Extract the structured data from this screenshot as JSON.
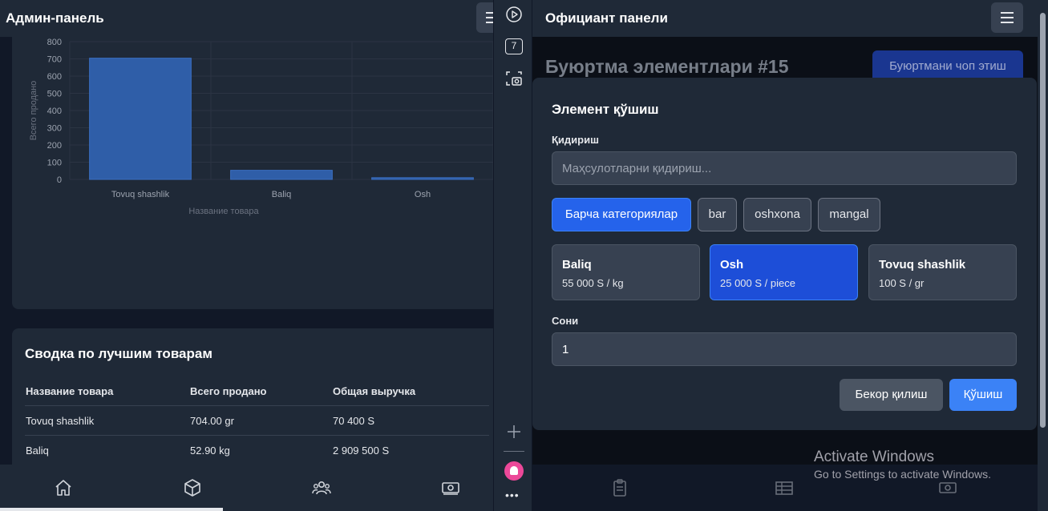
{
  "admin": {
    "title": "Админ-панель",
    "chart_data": {
      "type": "bar",
      "categories": [
        "Tovuq shashlik",
        "Baliq",
        "Osh"
      ],
      "values": [
        704,
        52.9,
        10
      ],
      "xlabel": "Название товара",
      "ylabel": "Всего продано",
      "ylim": [
        0,
        800
      ],
      "yticks": [
        "0",
        "100",
        "200",
        "300",
        "400",
        "500",
        "600",
        "700",
        "800"
      ],
      "grid": true,
      "bar_color": "#2f5ea8"
    },
    "summary": {
      "title": "Сводка по лучшим товарам",
      "columns": [
        "Название товара",
        "Всего продано",
        "Общая выручка"
      ],
      "rows": [
        [
          "Tovuq shashlik",
          "704.00 gr",
          "70 400 S"
        ],
        [
          "Baliq",
          "52.90 kg",
          "2 909 500 S"
        ]
      ]
    },
    "nav_icons": [
      "home-icon",
      "box-icon",
      "users-icon",
      "cash-icon"
    ]
  },
  "strip": {
    "badge": "7",
    "icons": [
      "play-icon",
      "screenshot-icon",
      "plus-icon",
      "avatar-icon",
      "more-icon"
    ],
    "more": "•••"
  },
  "waiter": {
    "title": "Официант панели",
    "order_title": "Буюртма элементлари #15",
    "print_button": "Буюртмани чоп этиш",
    "modal": {
      "title": "Элемент қўшиш",
      "search_label": "Қидириш",
      "search_placeholder": "Маҳсулотларни қидириш...",
      "categories": [
        "Барча категориялар",
        "bar",
        "oshxona",
        "mangal"
      ],
      "active_category": "Барча категориялар",
      "products": [
        {
          "name": "Baliq",
          "price": "55 000 S / kg"
        },
        {
          "name": "Osh",
          "price": "25 000 S / piece"
        },
        {
          "name": "Tovuq shashlik",
          "price": "100 S / gr"
        }
      ],
      "selected_product": "Osh",
      "qty_label": "Сони",
      "qty_value": "1",
      "cancel": "Бекор қилиш",
      "add": "Қўшиш"
    },
    "nav_icons": [
      "clipboard-icon",
      "table-icon",
      "cash-icon"
    ]
  },
  "windows": {
    "title": "Activate Windows",
    "subtitle": "Go to Settings to activate Windows."
  },
  "colors": {
    "accent": "#2563eb",
    "bg": "#111827",
    "card": "#1f2937"
  }
}
